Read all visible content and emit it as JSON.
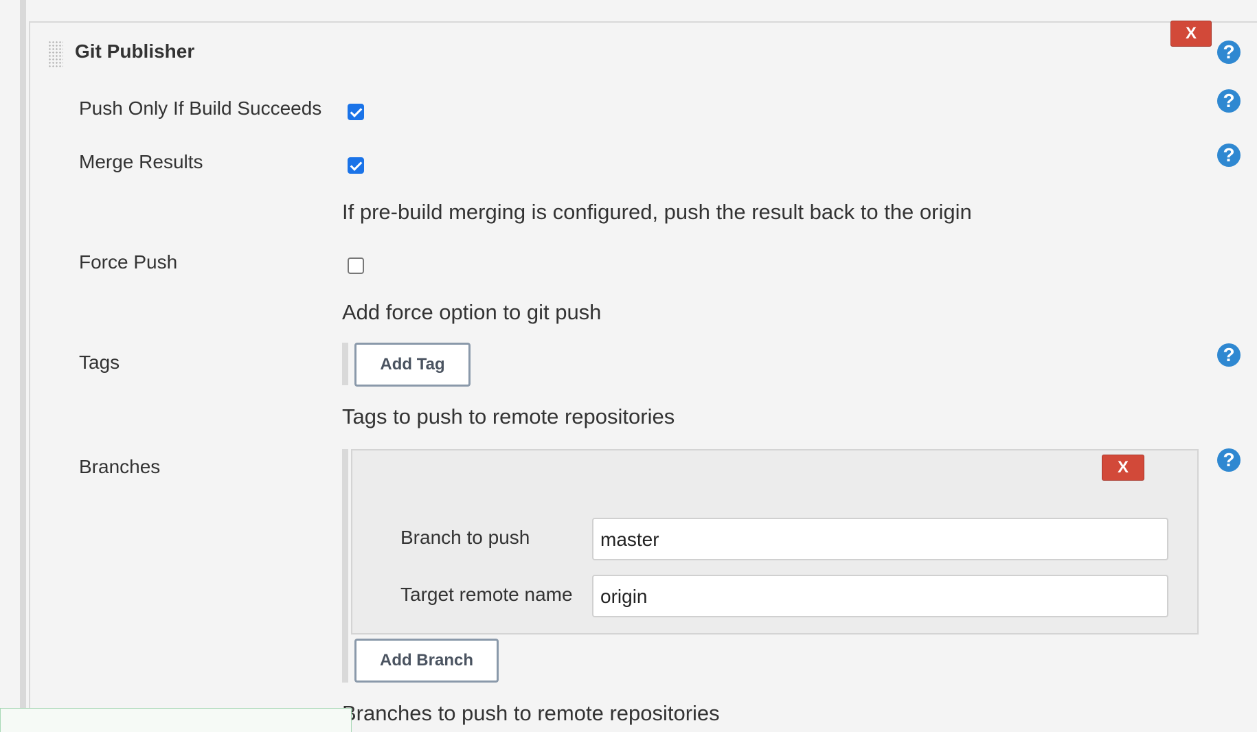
{
  "publisher": {
    "title": "Git Publisher",
    "delete_label": "X"
  },
  "help_icon_glyph": "?",
  "fields": {
    "push_only_if_build_succeeds": {
      "label": "Push Only If Build Succeeds",
      "checked": true
    },
    "merge_results": {
      "label": "Merge Results",
      "checked": true,
      "description": "If pre-build merging is configured, push the result back to the origin"
    },
    "force_push": {
      "label": "Force Push",
      "checked": false,
      "description": "Add force option to git push"
    },
    "tags": {
      "label": "Tags",
      "add_button": "Add Tag",
      "description": "Tags to push to remote repositories"
    },
    "branches": {
      "label": "Branches",
      "add_button": "Add Branch",
      "description": "Branches to push to remote repositories",
      "items": [
        {
          "delete_label": "X",
          "branch_label": "Branch to push",
          "branch_value": "master",
          "remote_label": "Target remote name",
          "remote_value": "origin"
        }
      ]
    }
  },
  "colors": {
    "delete_button": "#d24939",
    "help_icon": "#2f88d1",
    "checkbox_checked": "#1a73e8",
    "button_border": "#8a99aa"
  }
}
